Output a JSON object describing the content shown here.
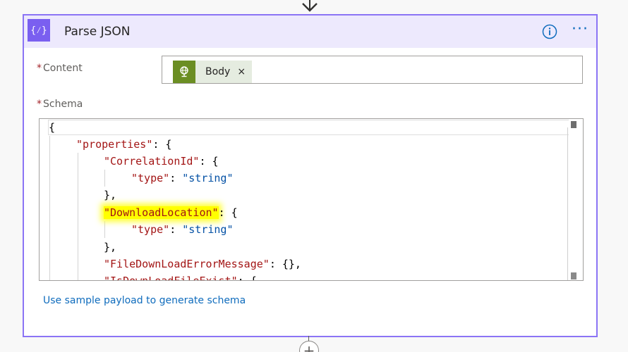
{
  "action": {
    "title": "Parse JSON",
    "icon": "braces-icon",
    "accent_color": "#8b74f5",
    "header_bg": "#ede9fd",
    "icon_glyph": "{⁄}"
  },
  "header_actions": {
    "info_icon": "info-icon",
    "more_label": "···"
  },
  "content_field": {
    "required_mark": "*",
    "label": "Content",
    "token": {
      "label": "Body",
      "icon": "globe-icon",
      "remove_label": "×"
    }
  },
  "schema_field": {
    "required_mark": "*",
    "label": "Schema",
    "code": {
      "line1": "{",
      "line2_key": "\"properties\"",
      "line2_rest": ": {",
      "line3_key": "\"CorrelationId\"",
      "line3_rest": ": {",
      "line4_key": "\"type\"",
      "line4_sep": ": ",
      "line4_val": "\"string\"",
      "line5": "},",
      "line6_key": "\"DownloadLocation\"",
      "line6_rest": ": {",
      "line7_key": "\"type\"",
      "line7_sep": ": ",
      "line7_val": "\"string\"",
      "line8": "},",
      "line9_key": "\"FileDownLoadErrorMessage\"",
      "line9_rest": ": {},",
      "line10_key": "\"IsDownLoadFileExist\"",
      "line10_rest": ": {"
    }
  },
  "sample_link": "Use sample payload to generate schema",
  "add_step_label": "+"
}
